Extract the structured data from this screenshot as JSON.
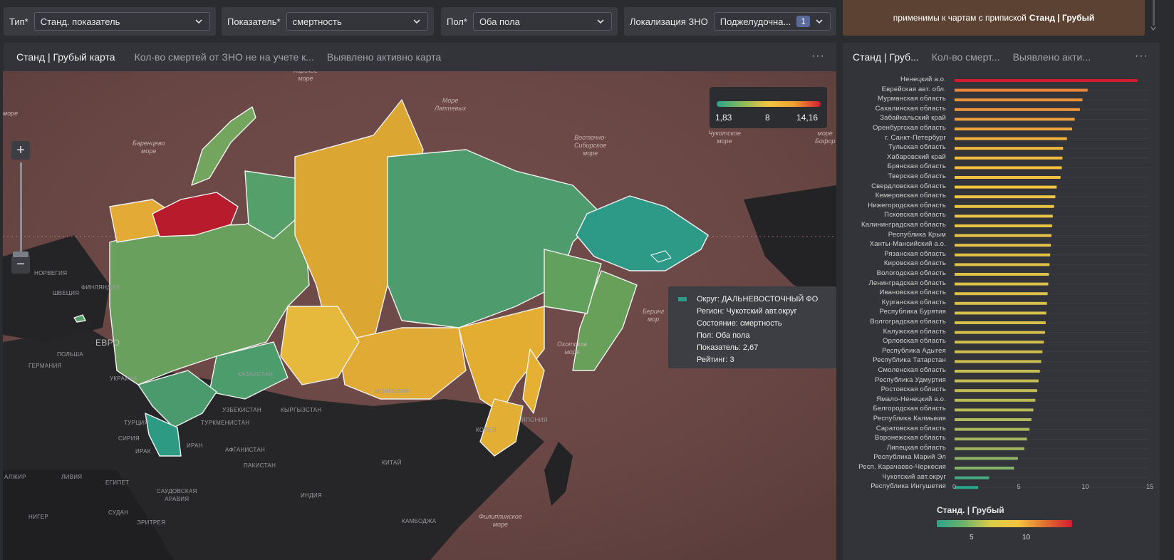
{
  "filters": [
    {
      "label": "Тип*",
      "value": "Станд. показатель"
    },
    {
      "label": "Показатель*",
      "value": "смертность"
    },
    {
      "label": "Пол*",
      "value": "Оба пола"
    },
    {
      "label": "Локализация ЗНО",
      "value": "Поджелудочна...",
      "count": "1"
    }
  ],
  "note": {
    "text": "применимы к чартам с припиской",
    "bold": "Станд | Грубый"
  },
  "map_panel": {
    "tabs": [
      "Станд | Грубый карта",
      "Кол-во смертей от ЗНО не на учете к...",
      "Выявлено активно карта"
    ],
    "menu": "···",
    "zoom_in": "+",
    "zoom_out": "−",
    "legend": {
      "min": "1,83",
      "mid": "8",
      "max": "14,16"
    },
    "labels": {
      "kara": "Карское\nморе",
      "laptev": "Море\nЛаптевых",
      "barents": "Баренцево\nморе",
      "esib": "Восточно-\nСибирское\nморе",
      "chukot": "Чукотское\nморе",
      "okhotsk": "Охотское\nморе",
      "bering": "Беринг\nмор",
      "philippine": "Филиппинское\nморе",
      "moreL": "море",
      "moreR": "море\nБофор",
      "kazakhstan": "КАЗАХСТАН",
      "mongolia": "МОНГОЛИЯ",
      "uzbekistan": "УЗБЕКИСТАН",
      "kyrgyzstan": "КЫРГЫЗСТАН",
      "turkmenistan": "ТУРКМЕНИСТАН",
      "turkey": "ТУРЦИЯ",
      "iran": "ИРАН",
      "afghanistan": "АФГАНИСТАН",
      "pakistan": "ПАКИСТАН",
      "india": "ИНДИЯ",
      "china": "КИТАЙ",
      "japan": "ЯПОНИЯ",
      "korea": "КОРЕЯ",
      "ukraine": "УКРАИНА",
      "poland": "ПОЛЬША",
      "germany": "ГЕРМАНИЯ",
      "norway": "НОРВЕГИЯ",
      "sweden": "ШВЕЦИЯ",
      "finland": "ФИНЛЯНДИЯ",
      "egypt": "ЕГИПЕТ",
      "libya": "ЛИВИЯ",
      "algeria": "АЛЖИР",
      "saudi": "САУДОВСКАЯ\nАРАВИЯ",
      "sudan": "СУДАН",
      "niger": "НИГЕР",
      "eritrea": "ЭРИТРЕЯ",
      "cambodia": "КАМБОДЖА",
      "iraq": "ИРАК",
      "syria": "СИРИЯ",
      "europe": "ЕВРО"
    },
    "tooltip": {
      "okrug": "Округ: ДАЛЬНЕВОСТОЧНЫЙ ФО",
      "region": "Регион: Чукотский авт.округ",
      "state": "Состояние: смертность",
      "sex": "Пол: Оба пола",
      "value": "Показатель: 2,67",
      "rating": "Рейтинг: 3"
    }
  },
  "bar_panel": {
    "tabs": [
      "Станд | Груб...",
      "Кол-во смерт...",
      "Выявлено акти..."
    ],
    "menu": "···",
    "legend_title": "Станд. | Грубый",
    "legend_ticks": [
      "5",
      "10"
    ]
  },
  "colors": {
    "low": "#2aa38a",
    "mid": "#f5c540",
    "high": "#d41c30"
  },
  "chart_data": {
    "type": "bar",
    "orientation": "horizontal",
    "categories": [
      "Ненецкий а.о.",
      "Еврейская авт. обл.",
      "Мурманская область",
      "Сахалинская область",
      "Забайкальский край",
      "Оренбургская область",
      "г. Санкт-Петербург",
      "Тульская область",
      "Хабаровский край",
      "Брянская область",
      "Тверская область",
      "Свердловская область",
      "Кемеровская область",
      "Нижегородская область",
      "Псковская область",
      "Калининградская область",
      "Республика Крым",
      "Ханты-Мансийский а.о.",
      "Рязанская область",
      "Кировская область",
      "Вологодская область",
      "Ленинградская область",
      "Ивановская область",
      "Курганская область",
      "Республика Бурятия",
      "Волгоградская область",
      "Калужская область",
      "Орловская область",
      "Республика Адыгея",
      "Республика Татарстан",
      "Смоленская область",
      "Республика Удмуртия",
      "Ростовская область",
      "Ямало-Ненецкий а.о.",
      "Белгородская область",
      "Республика Калмыкия",
      "Саратовская область",
      "Воронежская область",
      "Липецкая область",
      "Республика Марий Эл",
      "Респ. Карачаево-Черкесия",
      "Чукотский авт.округ",
      "Республика Ингушетия"
    ],
    "values": [
      14.16,
      10.3,
      9.9,
      9.7,
      9.3,
      9.1,
      8.7,
      8.4,
      8.35,
      8.3,
      8.2,
      7.9,
      7.8,
      7.7,
      7.6,
      7.55,
      7.5,
      7.45,
      7.4,
      7.35,
      7.3,
      7.25,
      7.2,
      7.15,
      7.1,
      7.05,
      7.0,
      6.9,
      6.8,
      6.7,
      6.6,
      6.5,
      6.4,
      6.25,
      6.1,
      5.95,
      5.8,
      5.6,
      5.4,
      4.9,
      4.6,
      2.67,
      1.83
    ],
    "xlim": [
      0,
      15
    ],
    "xticks": [
      0,
      5,
      10,
      15
    ],
    "color_scale": [
      1.83,
      8,
      14.16
    ]
  }
}
